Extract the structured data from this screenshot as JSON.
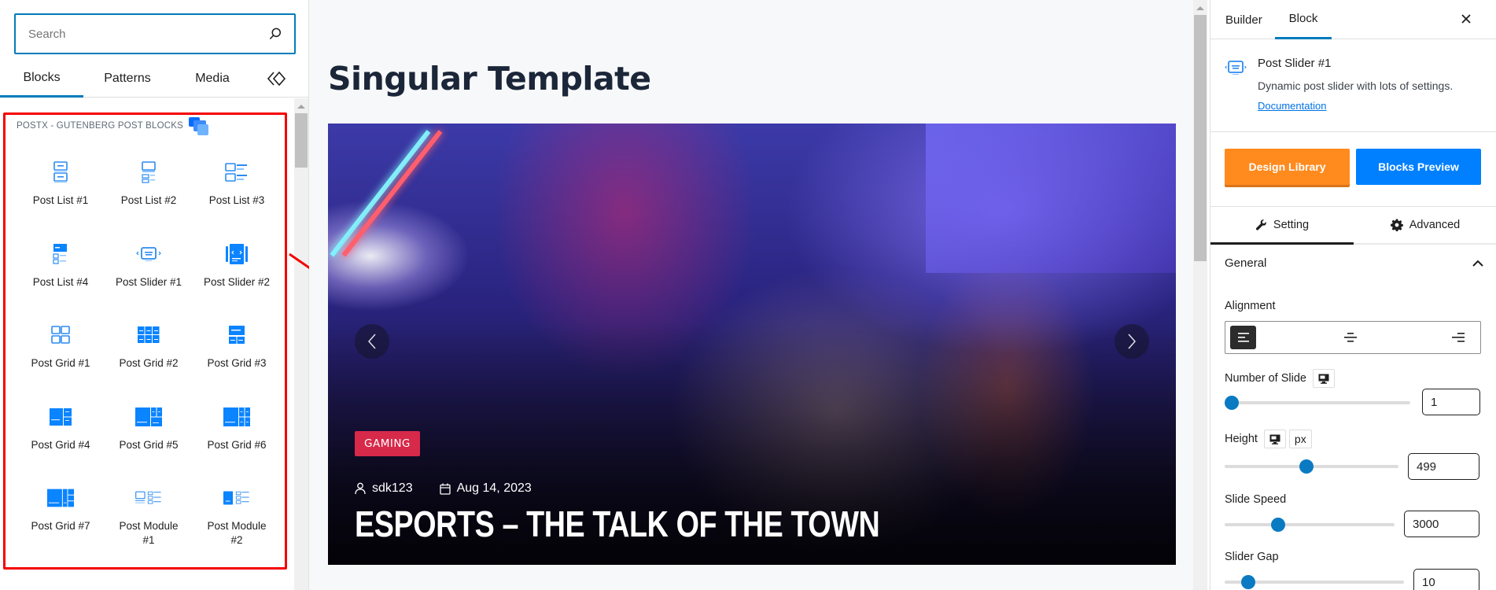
{
  "left_panel": {
    "search": {
      "placeholder": "Search",
      "value": ""
    },
    "tabs": [
      {
        "label": "Blocks",
        "active": true
      },
      {
        "label": "Patterns",
        "active": false
      },
      {
        "label": "Media",
        "active": false
      }
    ],
    "category": {
      "title": "POSTX - GUTENBERG POST BLOCKS",
      "blocks": [
        {
          "label": "Post List #1",
          "icon": "post-list-1-icon"
        },
        {
          "label": "Post List #2",
          "icon": "post-list-2-icon"
        },
        {
          "label": "Post List #3",
          "icon": "post-list-3-icon"
        },
        {
          "label": "Post List #4",
          "icon": "post-list-4-icon"
        },
        {
          "label": "Post Slider #1",
          "icon": "post-slider-1-icon"
        },
        {
          "label": "Post Slider #2",
          "icon": "post-slider-2-icon"
        },
        {
          "label": "Post Grid #1",
          "icon": "post-grid-1-icon"
        },
        {
          "label": "Post Grid #2",
          "icon": "post-grid-2-icon"
        },
        {
          "label": "Post Grid #3",
          "icon": "post-grid-3-icon"
        },
        {
          "label": "Post Grid #4",
          "icon": "post-grid-4-icon"
        },
        {
          "label": "Post Grid #5",
          "icon": "post-grid-5-icon"
        },
        {
          "label": "Post Grid #6",
          "icon": "post-grid-6-icon"
        },
        {
          "label": "Post Grid #7",
          "icon": "post-grid-7-icon"
        },
        {
          "label": "Post Module #1",
          "icon": "post-module-1-icon"
        },
        {
          "label": "Post Module #2",
          "icon": "post-module-2-icon"
        }
      ]
    }
  },
  "canvas": {
    "page_title": "Singular Template",
    "slide": {
      "category_badge": "GAMING",
      "author": "sdk123",
      "date": "Aug 14, 2023",
      "headline": "ESPORTS – THE TALK OF THE TOWN"
    }
  },
  "right_panel": {
    "tabs": [
      {
        "label": "Builder",
        "active": false
      },
      {
        "label": "Block",
        "active": true
      }
    ],
    "block": {
      "name": "Post Slider #1",
      "description": "Dynamic post slider with lots of settings.",
      "doc_link": "Documentation"
    },
    "buttons": {
      "design_library": "Design Library",
      "blocks_preview": "Blocks Preview"
    },
    "setting_tabs": [
      {
        "label": "Setting",
        "active": true
      },
      {
        "label": "Advanced",
        "active": false
      }
    ],
    "section": {
      "title": "General",
      "expanded": true
    },
    "fields": {
      "alignment": {
        "label": "Alignment",
        "options": [
          "left",
          "center",
          "right"
        ],
        "selected": "left"
      },
      "number_of_slide": {
        "label": "Number of Slide",
        "value": "1",
        "slider_fraction": 0.0
      },
      "height": {
        "label": "Height",
        "unit": "px",
        "value": "499",
        "slider_fraction": 0.47
      },
      "slide_speed": {
        "label": "Slide Speed",
        "value": "3000",
        "slider_fraction": 0.3
      },
      "slider_gap": {
        "label": "Slider Gap",
        "value": "10",
        "slider_fraction": 0.1
      }
    }
  },
  "colors": {
    "accent": "#007cba",
    "annotation_red": "#f50000",
    "badge_red": "#d7294a",
    "design_library_orange": "#ff8a1e",
    "blocks_preview_blue": "#0080ff",
    "block_icon_blue": "#0a84ff"
  }
}
